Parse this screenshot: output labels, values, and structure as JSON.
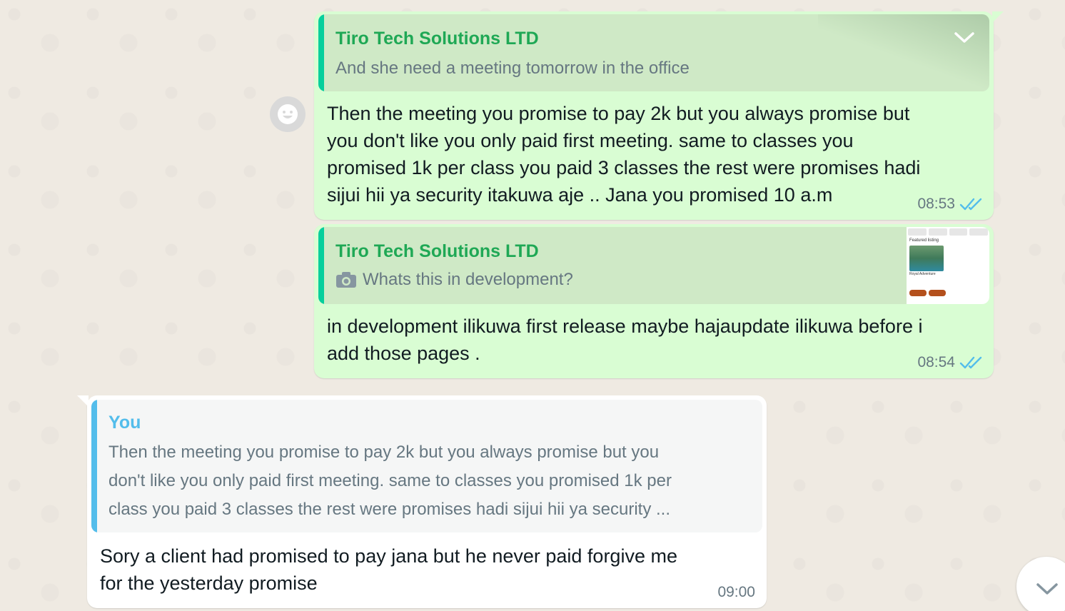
{
  "messages": [
    {
      "id": "m1",
      "quote": {
        "author": "Tiro Tech Solutions LTD",
        "text": "And she need a meeting tomorrow in the office"
      },
      "lines": [
        "Then the meeting you promise to pay 2k but you always promise but",
        "you don't  like you only paid first meeting. same to classes you",
        "promised 1k per class you paid 3 classes the rest were promises hadi",
        "sijui hii ya security itakuwa aje .. Jana you promised 10 a.m"
      ],
      "time": "08:53",
      "status": "read"
    },
    {
      "id": "m2",
      "quote": {
        "author": "Tiro Tech Solutions LTD",
        "text": "Whats this in development?",
        "thumbnail": {
          "heading": "Featured listing",
          "caption": "Royal Adventure"
        }
      },
      "lines": [
        "in development ilikuwa first release maybe hajaupdate ilikuwa before i",
        "add those pages ."
      ],
      "time": "08:54",
      "status": "read"
    },
    {
      "id": "m3",
      "quote": {
        "author": "You",
        "lines": [
          "Then the meeting you promise to pay 2k but you always promise but you",
          "don't  like you only paid first meeting. same to classes you promised 1k per",
          "class you paid 3 classes the rest were promises hadi sijui hii ya security ..."
        ]
      },
      "lines": [
        "Sory a client had promised to pay jana but he never paid forgive me",
        "for the yesterday promise"
      ],
      "time": "09:00"
    }
  ],
  "colors": {
    "outgoing_bubble": "#d9fdd3",
    "incoming_bubble": "#ffffff",
    "quote_green": "#06cf9c",
    "quote_blue": "#53bdeb",
    "read_ticks": "#53bdeb"
  },
  "icons": [
    "reaction-emoji-icon",
    "camera-icon",
    "chevron-down-icon",
    "double-check-icon"
  ]
}
